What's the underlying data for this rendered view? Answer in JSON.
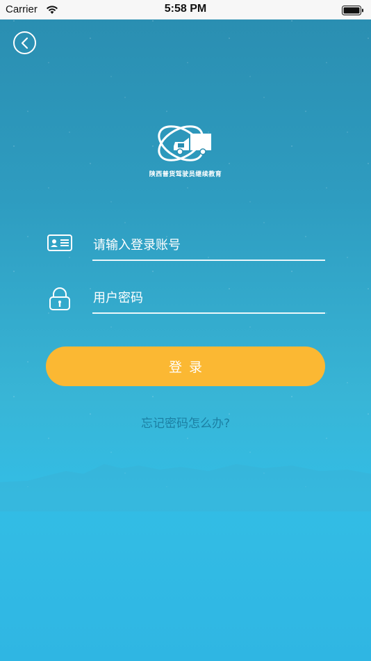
{
  "status_bar": {
    "carrier": "Carrier",
    "time": "5:58 PM"
  },
  "app": {
    "logo_caption": "陕西普货驾驶员继续教育"
  },
  "form": {
    "account_placeholder": "请输入登录账号",
    "password_placeholder": "用户密码",
    "login_label": "登录",
    "forgot_label": "忘记密码怎么办?"
  },
  "colors": {
    "accent_button": "#fbb833",
    "link": "#1b7fa3",
    "background_top": "#2a8db0",
    "background_bottom": "#2fb6e3"
  },
  "icons": {
    "back": "chevron-left-icon",
    "account": "id-card-icon",
    "password": "lock-icon",
    "wifi": "wifi-icon",
    "battery": "battery-icon",
    "logo": "truck-orbit-logo"
  }
}
